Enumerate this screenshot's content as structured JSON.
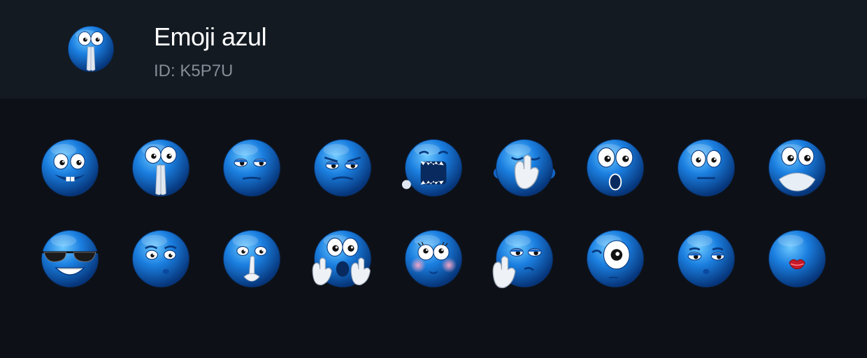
{
  "pack": {
    "title": "Emoji azul",
    "id_label": "ID: K5P7U"
  },
  "colors": {
    "background": "#0d1117",
    "header": "#131a22",
    "emoji_blue": "#1b7fe0",
    "subtitle": "#868d96"
  },
  "stickers": [
    {
      "name": "goofy-grin-emoji",
      "face": "grin-goofy"
    },
    {
      "name": "praying-hands-emoji",
      "face": "pray"
    },
    {
      "name": "unamused-emoji",
      "face": "unamused"
    },
    {
      "name": "annoyed-emoji",
      "face": "annoyed"
    },
    {
      "name": "screaming-emoji",
      "face": "scream"
    },
    {
      "name": "facepalm-emoji",
      "face": "facepalm"
    },
    {
      "name": "shocked-emoji",
      "face": "shocked"
    },
    {
      "name": "neutral-emoji",
      "face": "neutral"
    },
    {
      "name": "hands-over-mouth-emoji",
      "face": "handsmouth"
    },
    {
      "name": "sunglasses-emoji",
      "face": "sunglasses"
    },
    {
      "name": "sad-pout-emoji",
      "face": "sadpout"
    },
    {
      "name": "shush-emoji",
      "face": "shush"
    },
    {
      "name": "surprised-hands-emoji",
      "face": "surprisedhands"
    },
    {
      "name": "blushing-emoji",
      "face": "blush"
    },
    {
      "name": "ok-hand-emoji",
      "face": "okhand"
    },
    {
      "name": "one-eye-emoji",
      "face": "oneeye"
    },
    {
      "name": "pouting-lips-emoji",
      "face": "pout"
    },
    {
      "name": "kissing-lips-emoji",
      "face": "kiss"
    }
  ]
}
